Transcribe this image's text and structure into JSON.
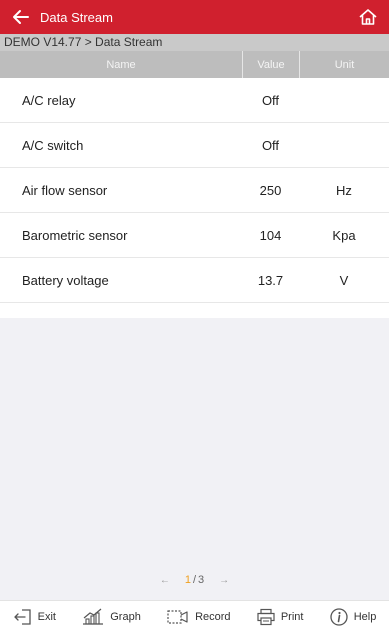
{
  "header": {
    "title": "Data Stream",
    "accent_color": "#d0202e"
  },
  "breadcrumb": "DEMO V14.77 > Data Stream",
  "table": {
    "columns": [
      "Name",
      "Value",
      "Unit"
    ],
    "rows": [
      {
        "name": "A/C relay",
        "value": "Off",
        "unit": ""
      },
      {
        "name": "A/C switch",
        "value": "Off",
        "unit": ""
      },
      {
        "name": "Air flow sensor",
        "value": "250",
        "unit": "Hz"
      },
      {
        "name": "Barometric sensor",
        "value": "104",
        "unit": "Kpa"
      },
      {
        "name": "Battery voltage",
        "value": "13.7",
        "unit": "V"
      }
    ]
  },
  "pager": {
    "current": "1",
    "separator": "/",
    "total": "3",
    "prev": "←",
    "next": "→"
  },
  "toolbar": {
    "exit": "Exit",
    "graph": "Graph",
    "record": "Record",
    "print": "Print",
    "help": "Help"
  },
  "icons": {
    "back": "arrow-left-icon",
    "home": "home-icon",
    "exit": "exit-icon",
    "graph": "graph-icon",
    "record": "record-icon",
    "print": "printer-icon",
    "help": "help-icon"
  }
}
